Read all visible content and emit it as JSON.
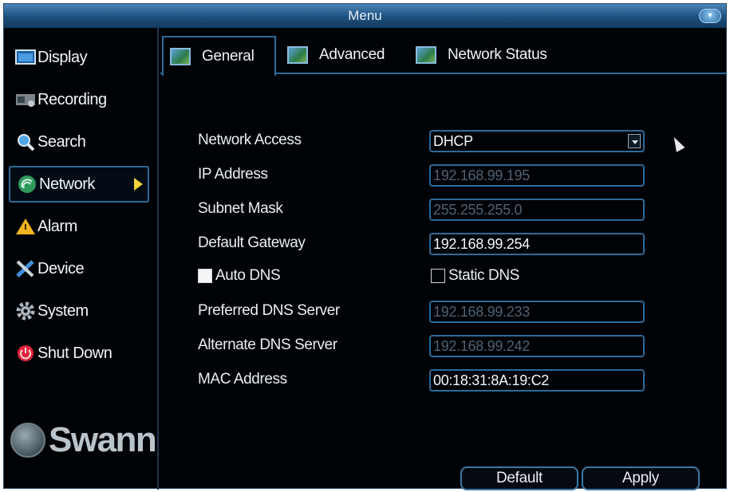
{
  "window": {
    "title": "Menu"
  },
  "sidebar": {
    "items": [
      {
        "label": "Display",
        "icon": "display-icon",
        "active": false
      },
      {
        "label": "Recording",
        "icon": "recording-icon",
        "active": false
      },
      {
        "label": "Search",
        "icon": "search-icon",
        "active": false
      },
      {
        "label": "Network",
        "icon": "network-icon",
        "active": true
      },
      {
        "label": "Alarm",
        "icon": "alarm-icon",
        "active": false
      },
      {
        "label": "Device",
        "icon": "device-icon",
        "active": false
      },
      {
        "label": "System",
        "icon": "gear-icon",
        "active": false
      },
      {
        "label": "Shut Down",
        "icon": "power-icon",
        "active": false
      }
    ],
    "logo": "Swann"
  },
  "tabs": [
    {
      "label": "General",
      "active": true
    },
    {
      "label": "Advanced",
      "active": false
    },
    {
      "label": "Network Status",
      "active": false
    }
  ],
  "form": {
    "network_access": {
      "label": "Network Access",
      "value": "DHCP"
    },
    "ip_address": {
      "label": "IP Address",
      "value": "192.168.99.195"
    },
    "subnet_mask": {
      "label": "Subnet Mask",
      "value": "255.255.255.0"
    },
    "default_gateway": {
      "label": "Default Gateway",
      "value": "192.168.99.254"
    },
    "auto_dns": {
      "label": "Auto DNS",
      "checked": true
    },
    "static_dns": {
      "label": "Static DNS",
      "checked": false
    },
    "preferred_dns": {
      "label": "Preferred DNS Server",
      "value": "192.168.99.233"
    },
    "alternate_dns": {
      "label": "Alternate DNS Server",
      "value": "192.168.99.242"
    },
    "mac_address": {
      "label": "MAC Address",
      "value": "00:18:31:8A:19:C2"
    }
  },
  "buttons": {
    "default_label": "Default",
    "apply_label": "Apply"
  },
  "colors": {
    "accent": "#2d6a9a",
    "background": "#000306",
    "arrow": "#f2d43a"
  }
}
